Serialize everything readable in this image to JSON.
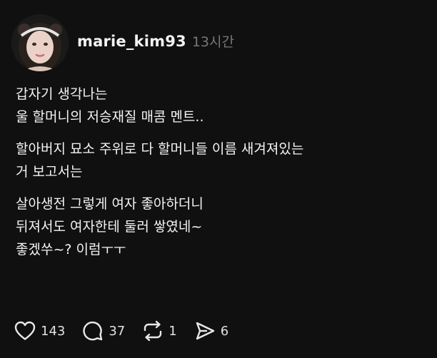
{
  "post": {
    "author": {
      "username": "marie_kim93",
      "posted_ago": "13시간",
      "avatar_icon": "profile-photo-avatar"
    },
    "paragraphs": [
      {
        "lines": [
          "갑자기 생각나는",
          "울 할머니의 저승재질 매콤 멘트.."
        ]
      },
      {
        "lines": [
          "할아버지 묘소 주위로 다 할머니들 이름 새겨져있는",
          "거 보고서는"
        ]
      },
      {
        "lines": [
          "살아생전 그렇게 여자 좋아하더니",
          "뒤져서도 여자한테 둘러 쌓였네~",
          "좋겠쑤~? 이럼ㅜㅜ"
        ]
      }
    ],
    "actions": {
      "like": {
        "icon": "heart-icon",
        "count": "143"
      },
      "reply": {
        "icon": "comment-icon",
        "count": "37"
      },
      "repost": {
        "icon": "repost-icon",
        "count": "1"
      },
      "share": {
        "icon": "send-icon",
        "count": "6"
      }
    },
    "colors": {
      "background": "#101010",
      "text": "#f3f3f3",
      "muted": "#777777"
    }
  }
}
